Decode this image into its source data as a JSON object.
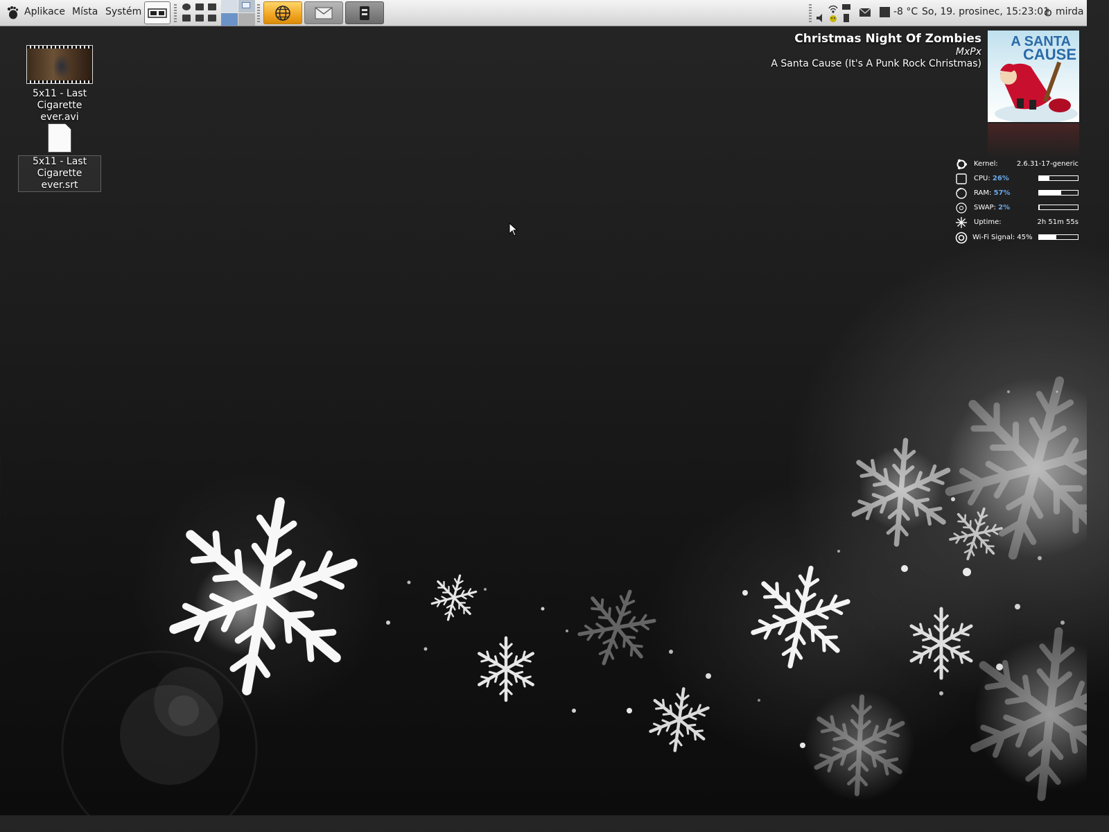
{
  "panel": {
    "menus": [
      {
        "label": "Aplikace"
      },
      {
        "label": "Místa"
      },
      {
        "label": "Systém"
      }
    ],
    "launchers": [
      {
        "name": "web-browser",
        "icon": "globe-icon",
        "color": "#f2a521"
      },
      {
        "name": "mail",
        "icon": "envelope-icon",
        "color": "#8e8e8e"
      },
      {
        "name": "terminal",
        "icon": "terminal-icon",
        "color": "#6a6a6a"
      }
    ],
    "weather": "-8 °C",
    "clock": "So, 19. prosinec, 15:23:01",
    "user": "mirda"
  },
  "desktop": {
    "icons": [
      {
        "line1": "5x11 - Last",
        "line2": "Cigarette ever.avi",
        "type": "video-thumbnail"
      },
      {
        "line1": "5x11 - Last",
        "line2": "Cigarette ever.srt",
        "type": "text-file"
      }
    ]
  },
  "now_playing": {
    "title": "Christmas Night Of Zombies",
    "artist": "MxPx",
    "album": "A Santa Cause (It's A Punk Rock Christmas)",
    "cover_text_line1": "A SANTA",
    "cover_text_line2": "CAUSE"
  },
  "conky": {
    "kernel_label": "Kernel:",
    "kernel_value": "2.6.31-17-generic",
    "cpu_label": "CPU:",
    "cpu_pct": "26%",
    "cpu_level": 0.26,
    "ram_label": "RAM:",
    "ram_pct": "57%",
    "ram_level": 0.57,
    "swap_label": "SWAP:",
    "swap_pct": "2%",
    "swap_level": 0.02,
    "uptime_label": "Uptime:",
    "uptime_value": "2h 51m 55s",
    "wifi_label": "Wi-Fi Signal: 45%",
    "wifi_level": 0.45,
    "accent_color": "#6aa9e9"
  }
}
